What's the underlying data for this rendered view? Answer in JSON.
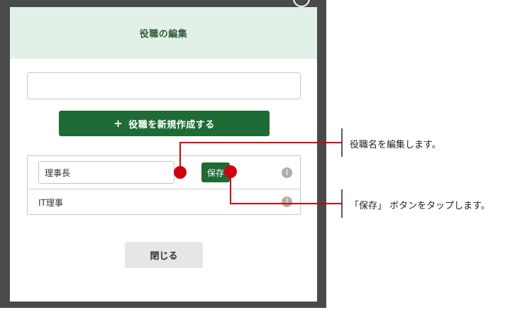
{
  "dialog": {
    "title": "役職の編集",
    "new_role_name_value": "",
    "create_button_label": "役職を新規作成する",
    "create_button_icon": "plus-icon",
    "close_button_label": "閉じる"
  },
  "roles": [
    {
      "name": "理事長",
      "editing": true,
      "save_label": "保存",
      "more_icon": "more-icon"
    },
    {
      "name": "IT理事",
      "editing": false,
      "more_icon": "more-icon"
    }
  ],
  "annotations": {
    "edit_name": "役職名を編集します。",
    "tap_save": "「保存」 ボタンをタップします。"
  },
  "colors": {
    "header_bg": "#e2f1e7",
    "primary_green": "#1f6b35",
    "callout_red": "#d0000f",
    "frame": "#4a4a4a"
  }
}
